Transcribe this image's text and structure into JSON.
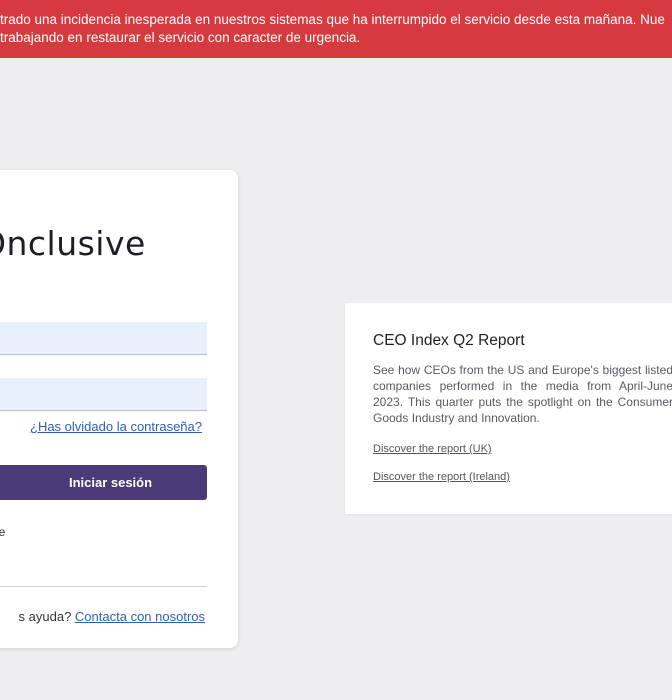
{
  "banner": {
    "line1": "trado una incidencia inesperada en nuestros sistemas que ha interrumpido el servicio desde esta mañana. Nue",
    "line2": "trabajando en restaurar el servicio con caracter de urgencia."
  },
  "login": {
    "logo": "Onclusive",
    "username_value": "",
    "password_value": "",
    "forgot_password": "¿Has olvidado la contraseña?",
    "submit_label": "Iniciar sesión",
    "remember_label": "ne",
    "help_text": "s ayuda?",
    "help_link": "Contacta con nosotros"
  },
  "report": {
    "title": "CEO Index Q2 Report",
    "description": "See how CEOs from the US and Europe's biggest listed companies performed in the media from April-June 2023. This quarter puts the spotlight on the Consumer Goods Industry and Innovation.",
    "link_uk": "Discover the report (UK)",
    "link_ireland": "Discover the report (Ireland)"
  },
  "colors": {
    "banner_bg": "#d73a3e",
    "button_bg": "#4b3a78",
    "link": "#2f5fb5",
    "page_bg": "#eeeef1"
  }
}
